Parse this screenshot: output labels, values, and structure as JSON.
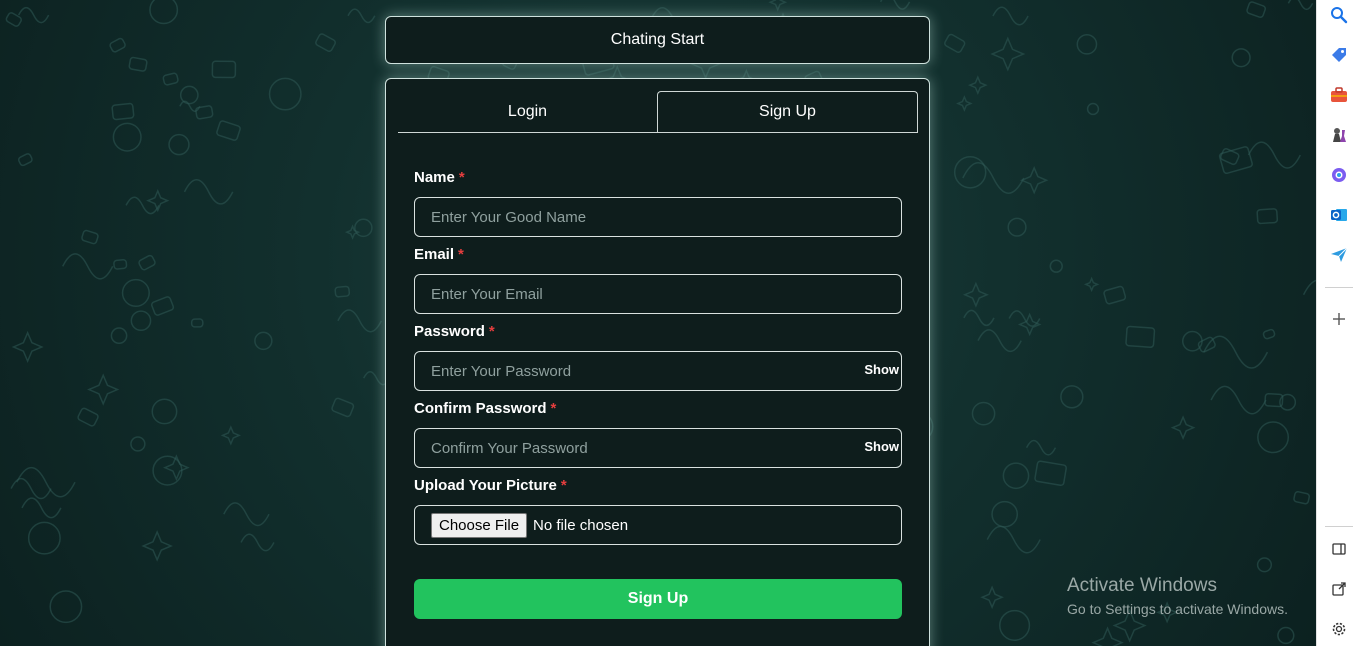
{
  "header": {
    "title": "Chating Start"
  },
  "tabs": {
    "login": "Login",
    "signup": "Sign Up"
  },
  "form": {
    "name": {
      "label": "Name",
      "required": "*",
      "placeholder": "Enter Your Good Name"
    },
    "email": {
      "label": "Email",
      "required": "*",
      "placeholder": "Enter Your Email"
    },
    "password": {
      "label": "Password",
      "required": "*",
      "placeholder": "Enter Your Password",
      "toggle": "Show"
    },
    "confirm": {
      "label": "Confirm Password",
      "required": "*",
      "placeholder": "Confirm Your Password",
      "toggle": "Show"
    },
    "picture": {
      "label": "Upload Your Picture",
      "required": "*",
      "button": "Choose File",
      "status": "No file chosen"
    },
    "submit": "Sign Up"
  },
  "watermark": {
    "title": "Activate Windows",
    "subtitle": "Go to Settings to activate Windows."
  },
  "sidebar": {
    "icons": [
      "search-icon",
      "tag-icon",
      "briefcase-icon",
      "chess-icon",
      "copilot-icon",
      "outlook-icon",
      "send-icon",
      "add-icon",
      "panel-icon",
      "external-link-icon",
      "gear-icon"
    ]
  },
  "colors": {
    "accent": "#22c35e",
    "required": "#e53e3e",
    "card": "#0e1d1c"
  }
}
